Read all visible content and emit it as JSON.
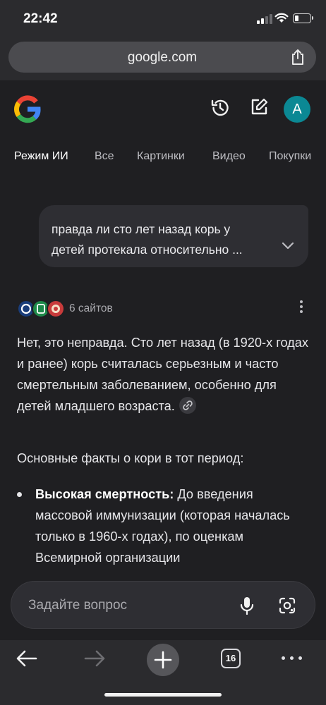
{
  "status_bar": {
    "time": "22:42",
    "battery_level": 0.25
  },
  "browser": {
    "url": "google.com"
  },
  "header": {
    "avatar_letter": "A"
  },
  "tabs": [
    {
      "label": "Режим ИИ",
      "active": true
    },
    {
      "label": "Все"
    },
    {
      "label": "Картинки"
    },
    {
      "label": "Видео"
    },
    {
      "label": "Покупки"
    }
  ],
  "query": {
    "line1": "правда ли сто лет назад корь у",
    "line2": "детей протекала относительно ..."
  },
  "sources": {
    "label": "6 сайтов"
  },
  "answer": {
    "paragraph1": "Нет, это неправда. Сто лет назад (в 1920-х годах и ранее) корь считалась серьезным и часто смертельным заболеванием, особенно для детей младшего возраста.",
    "paragraph2": "Основные факты о кори в тот период:",
    "bullet1_title": "Высокая смертность:",
    "bullet1_text": " До введения массовой иммунизации (которая началась только в 1960-х годах), по оценкам Всемирной организации"
  },
  "ask_bar": {
    "placeholder": "Задайте вопрос"
  },
  "bottom_nav": {
    "tab_count": "16"
  },
  "colors": {
    "accent_avatar": "#0b8894",
    "background": "#1f1f22"
  }
}
